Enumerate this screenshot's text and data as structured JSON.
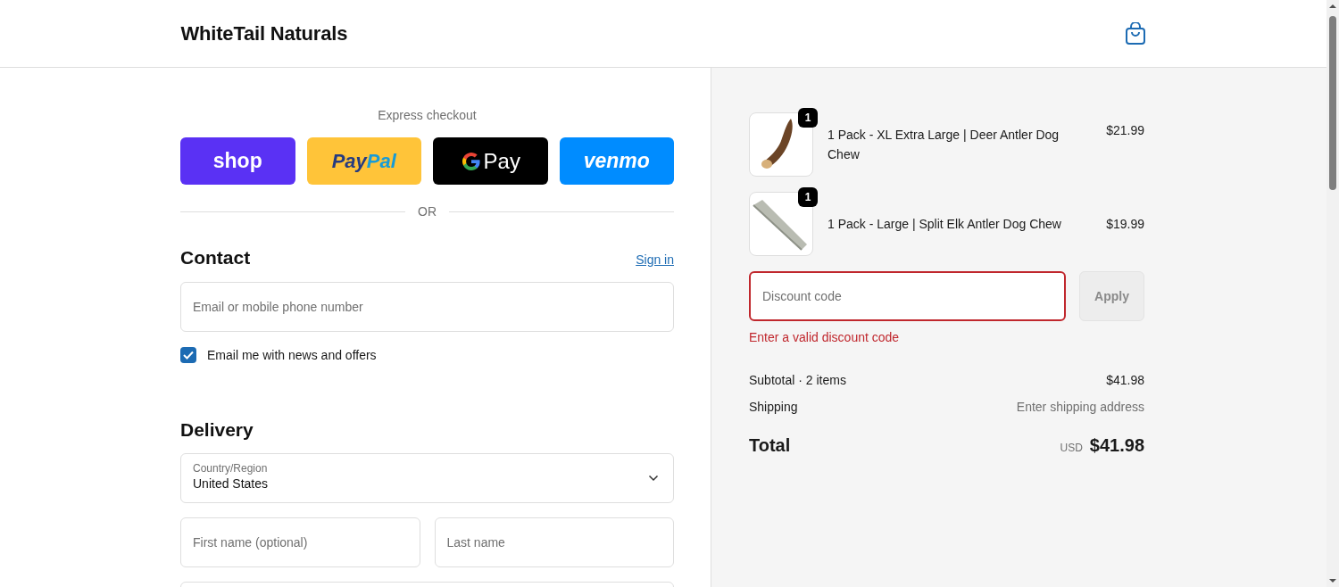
{
  "header": {
    "store_name": "WhiteTail Naturals"
  },
  "express_checkout": {
    "title": "Express checkout",
    "divider": "OR",
    "buttons": [
      {
        "kind": "shop",
        "label": "shop"
      },
      {
        "kind": "paypal",
        "label": "Pay",
        "label_2": "Pal"
      },
      {
        "kind": "gpay",
        "label": "Pay"
      },
      {
        "kind": "venmo",
        "label": "venmo"
      }
    ]
  },
  "contact": {
    "title": "Contact",
    "sign_in": "Sign in",
    "email_placeholder": "Email or mobile phone number",
    "newsletter": {
      "label": "Email me with news and offers",
      "checked": true
    }
  },
  "delivery": {
    "title": "Delivery",
    "country": {
      "label": "Country/Region",
      "value": "United States"
    },
    "first_name_placeholder": "First name (optional)",
    "last_name_placeholder": "Last name"
  },
  "summary": {
    "items": [
      {
        "kind": "curved",
        "name": "1 Pack - XL Extra Large | Deer Antler Dog Chew",
        "price": "$21.99",
        "quantity": "1"
      },
      {
        "kind": "split",
        "name": "1 Pack - Large | Split Elk Antler Dog Chew",
        "price": "$19.99",
        "quantity": "1"
      }
    ],
    "discount": {
      "placeholder": "Discount code",
      "error": true,
      "error_message": "Enter a valid discount code",
      "apply_label": "Apply",
      "apply_disabled": true
    },
    "subtotal_label": "Subtotal · 2 items",
    "subtotal": "$41.98",
    "shipping_label": "Shipping",
    "shipping": "Enter shipping address",
    "total_label": "Total",
    "currency": "USD",
    "total": "$41.98"
  }
}
